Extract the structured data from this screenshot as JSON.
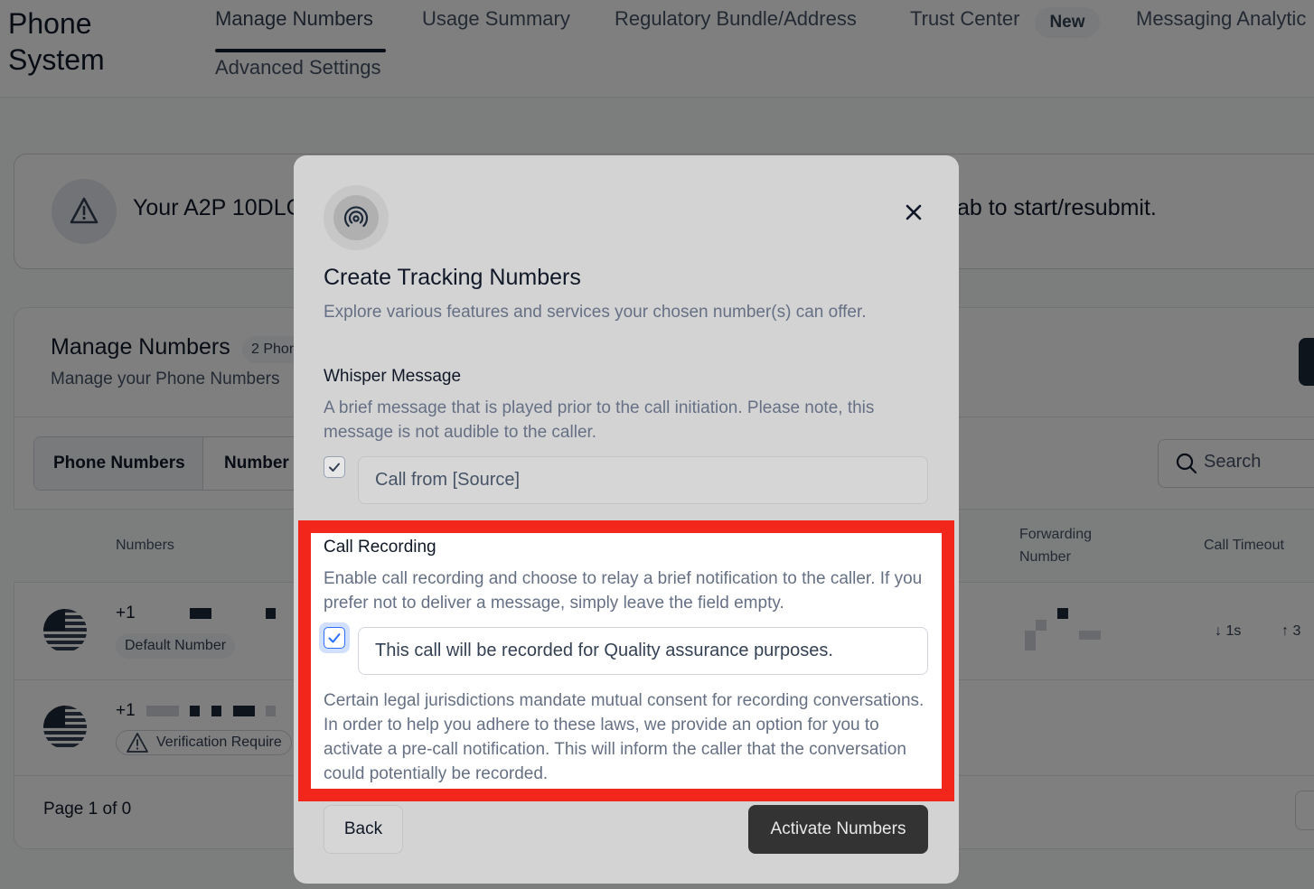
{
  "header": {
    "brand_line1": "Phone",
    "brand_line2": "System",
    "nav": [
      {
        "label": "Manage Numbers"
      },
      {
        "label": "Usage Summary"
      },
      {
        "label": "Regulatory Bundle/Address"
      },
      {
        "label": "Trust Center"
      },
      {
        "label": "Messaging Analytic"
      },
      {
        "label": "Advanced Settings"
      }
    ],
    "new_badge": "New",
    "active_nav": "Manage Numbers"
  },
  "alert": {
    "text_left": "Your A2P 10DLC",
    "text_right": "tab to start/resubmit.",
    "icon": "warning-triangle-icon"
  },
  "manage_numbers": {
    "title": "Manage Numbers",
    "count_badge": "2 Phon",
    "subtitle": "Manage your Phone Numbers",
    "tabs": [
      "Phone Numbers",
      "Number"
    ],
    "search_placeholder": "Search",
    "columns": {
      "numbers": "Numbers",
      "forwarding_line1": "Forwarding",
      "forwarding_line2": "Number",
      "call_timeout": "Call Timeout"
    },
    "rows": [
      {
        "prefix": "+1",
        "badge": "Default Number",
        "timeout_down": "1s",
        "timeout_up": "3"
      },
      {
        "prefix": "+1",
        "badge": "Verification Require"
      }
    ],
    "pagination": "Page 1 of 0"
  },
  "modal": {
    "title": "Create Tracking Numbers",
    "subtitle": "Explore various features and services your chosen number(s) can offer.",
    "whisper": {
      "title": "Whisper Message",
      "description": "A brief message that is played prior to the call initiation. Please note, this message is not audible to the caller.",
      "value": "Call from [Source]",
      "checked": true
    },
    "call_recording": {
      "title": "Call Recording",
      "description": "Enable call recording and choose to relay a brief notification to the caller. If you prefer not to deliver a message, simply leave the field empty.",
      "value": "This call will be recorded for Quality assurance purposes.",
      "checked": true,
      "note": "Certain legal jurisdictions mandate mutual consent for recording conversations. In order to help you adhere to these laws, we provide an option for you to activate a pre-call notification. This will inform the caller that the conversation could potentially be recorded."
    },
    "back_label": "Back",
    "activate_label": "Activate Numbers"
  },
  "colors": {
    "highlight": "#f3261b",
    "checkbox_accent": "#2970ff",
    "primary_button": "#333333"
  }
}
